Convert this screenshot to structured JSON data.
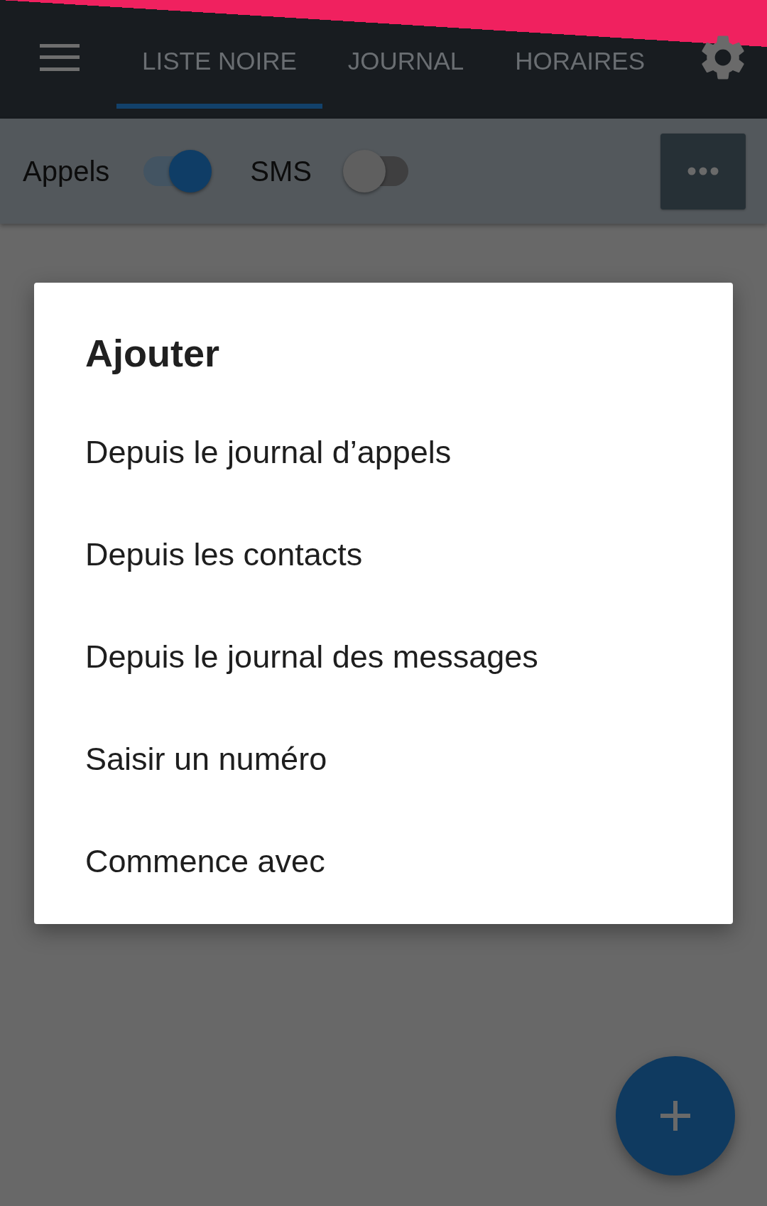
{
  "app_bar": {
    "tabs": [
      {
        "label": "LISTE NOIRE",
        "selected": true
      },
      {
        "label": "JOURNAL",
        "selected": false
      },
      {
        "label": "HORAIRES",
        "selected": false
      }
    ]
  },
  "filters": [
    {
      "label": "Appels",
      "on": true
    },
    {
      "label": "SMS",
      "on": false
    }
  ],
  "dialog": {
    "title": "Ajouter",
    "items": [
      "Depuis le journal d’appels",
      "Depuis les contacts",
      "Depuis le journal des messages",
      "Saisir un numéro",
      "Commence avec"
    ]
  }
}
